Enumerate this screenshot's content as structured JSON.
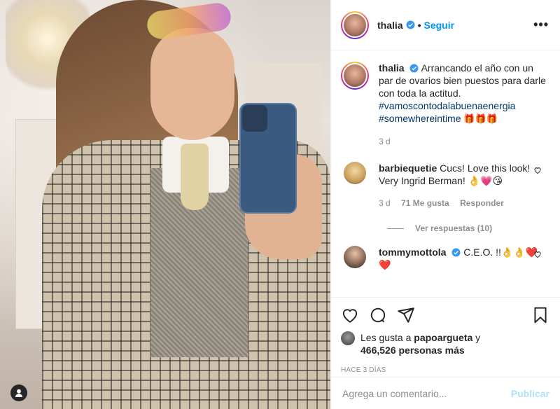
{
  "post": {
    "username": "thalia",
    "follow_label": "Seguir",
    "more_label": "•••",
    "caption_text": "Arrancando el año con un par de ovarios bien puestos para darle con toda la actitud.",
    "hashtag_1": "#vamoscontodalabuenaenergia",
    "hashtag_2": "#somewhereintime",
    "caption_emoji": "🎁🎁🎁",
    "caption_age": "3 d"
  },
  "comments": [
    {
      "username": "barbiequetie",
      "text": "Cucs! Love this look! Very Ingrid Berman! 👌💗😘",
      "age": "3 d",
      "likes": "71 Me gusta",
      "reply_label": "Responder",
      "view_replies": "Ver respuestas (10)"
    },
    {
      "username": "tommymottola",
      "text": "C.E.O. !!👌👌❤️❤️"
    }
  ],
  "likes": {
    "prefix": "Les gusta a ",
    "liker": "papoargueta",
    "conj": " y",
    "count": "466,526 personas más"
  },
  "timestamp": "HACE 3 DÍAS",
  "add_comment": {
    "placeholder": "Agrega un comentario...",
    "publish_label": "Publicar"
  },
  "colors": {
    "accent": "#0095f6",
    "publish_disabled": "#b2dffc",
    "verified": "#3897f0"
  }
}
